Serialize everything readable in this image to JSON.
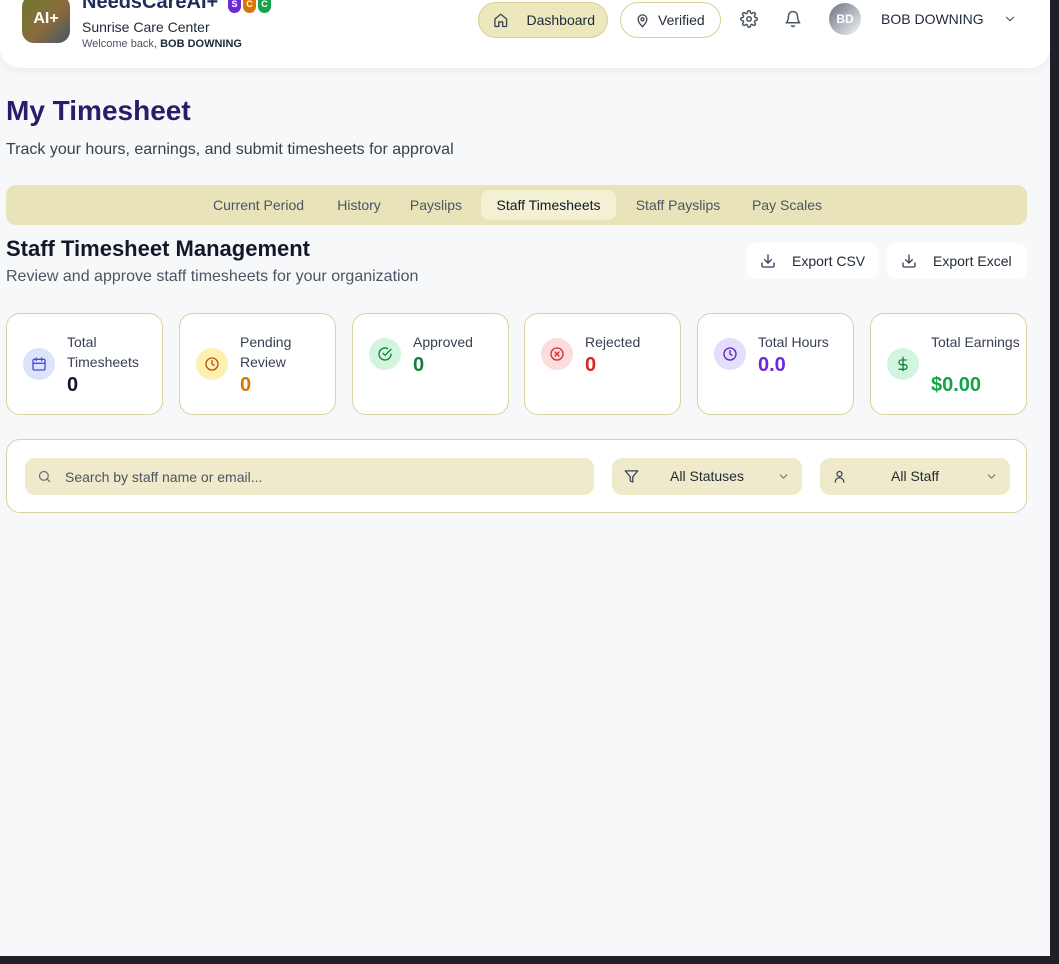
{
  "header": {
    "logo_text": "AI+",
    "brand_name": "NeedsCareAI+",
    "badges": [
      {
        "letter": "S",
        "color": "#6d28d9"
      },
      {
        "letter": "C",
        "color": "#d97706"
      },
      {
        "letter": "C",
        "color": "#16a34a"
      }
    ],
    "org_name": "Sunrise Care Center",
    "welcome_prefix": "Welcome back,",
    "welcome_name": "BOB DOWNING",
    "dashboard_label": "Dashboard",
    "verified_label": "Verified",
    "avatar_initials": "BD",
    "user_name": "BOB DOWNING"
  },
  "page": {
    "title": "My Timesheet",
    "subtitle": "Track your hours, earnings, and submit timesheets for approval"
  },
  "tabs": [
    {
      "label": "Current Period",
      "active": false
    },
    {
      "label": "History",
      "active": false
    },
    {
      "label": "Payslips",
      "active": false
    },
    {
      "label": "Staff Timesheets",
      "active": true
    },
    {
      "label": "Staff Payslips",
      "active": false
    },
    {
      "label": "Pay Scales",
      "active": false
    }
  ],
  "section": {
    "title": "Staff Timesheet Management",
    "subtitle": "Review and approve staff timesheets for your organization",
    "export_csv": "Export CSV",
    "export_excel": "Export Excel"
  },
  "stats": [
    {
      "label": "Total Timesheets",
      "value": "0",
      "icon": "calendar-icon",
      "value_color": "#111827",
      "icon_bg": "#dbe4fb",
      "icon_color": "#4f46e5"
    },
    {
      "label": "Pending Review",
      "value": "0",
      "icon": "clock-icon",
      "value_color": "#d97706",
      "icon_bg": "#fdf0b0",
      "icon_color": "#b45309"
    },
    {
      "label": "Approved",
      "value": "0",
      "icon": "check-circle-icon",
      "value_color": "#15803d",
      "icon_bg": "#d1f5de",
      "icon_color": "#15803d"
    },
    {
      "label": "Rejected",
      "value": "0",
      "icon": "x-circle-icon",
      "value_color": "#dc2626",
      "icon_bg": "#fcdcdc",
      "icon_color": "#dc2626"
    },
    {
      "label": "Total Hours",
      "value": "0.0",
      "icon": "clock-icon",
      "value_color": "#6d28d9",
      "icon_bg": "#e3defa",
      "icon_color": "#5b21b6"
    },
    {
      "label": "Total Earnings",
      "value": "$0.00",
      "icon": "dollar-icon",
      "value_color": "#16a34a",
      "icon_bg": "#d1f5de",
      "icon_color": "#15803d"
    }
  ],
  "filters": {
    "search_placeholder": "Search by staff name or email...",
    "status_value": "All Statuses",
    "staff_value": "All Staff"
  }
}
